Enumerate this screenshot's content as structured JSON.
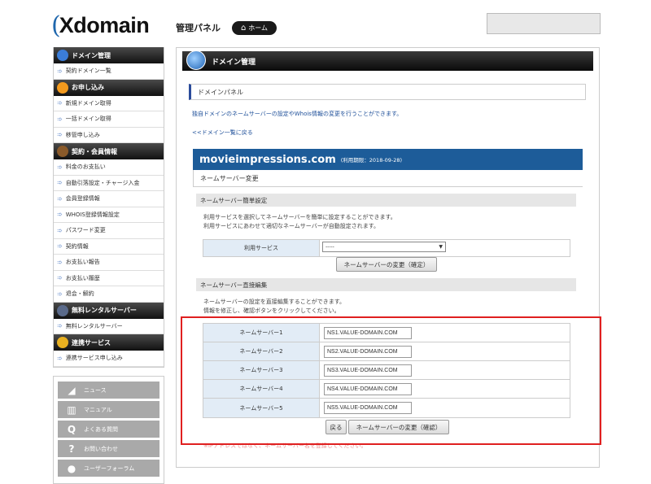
{
  "header": {
    "logo_text": "Xdomain",
    "panel_title": "管理パネル",
    "home_label": "ホーム"
  },
  "sidebar": {
    "sections": [
      {
        "title": "ドメイン管理",
        "icon": "globe-icon",
        "items": [
          "契約ドメイン一覧"
        ]
      },
      {
        "title": "お申し込み",
        "icon": "plus-icon",
        "items": [
          "新規ドメイン取得",
          "一括ドメイン取得",
          "移管申し込み"
        ]
      },
      {
        "title": "契約・会員情報",
        "icon": "user-icon",
        "items": [
          "料金のお支払い",
          "自動引落設定・チャージ入金",
          "会員登録情報",
          "WHOIS登録情報設定",
          "パスワード変更",
          "契約情報",
          "お支払い報告",
          "お支払い履歴",
          "退会・解約"
        ]
      },
      {
        "title": "無料レンタルサーバー",
        "icon": "server-icon",
        "items": [
          "無料レンタルサーバー"
        ]
      },
      {
        "title": "連携サービス",
        "icon": "link-icon",
        "items": [
          "連携サービス申し込み"
        ]
      }
    ],
    "support": [
      {
        "label": "ニュース",
        "icon": "megaphone-icon",
        "glyph": "◢"
      },
      {
        "label": "マニュアル",
        "icon": "book-icon",
        "glyph": "▥"
      },
      {
        "label": "よくある質問",
        "icon": "q-icon",
        "glyph": "Q"
      },
      {
        "label": "お問い合わせ",
        "icon": "question-icon",
        "glyph": "?"
      },
      {
        "label": "ユーザーフォーラム",
        "icon": "chat-icon",
        "glyph": "●"
      }
    ]
  },
  "main": {
    "title": "ドメイン管理",
    "panel_label": "ドメインパネル",
    "description": "独自ドメインのネームサーバーの設定やWhois情報の変更を行うことができます。",
    "back_link": "<<ドメイン一覧に戻る",
    "domain": "movieimpressions.com",
    "expiry": "(利用期限：2018-09-28)",
    "ns_change_title": "ネームサーバー変更",
    "simple": {
      "heading": "ネームサーバー簡単設定",
      "note1": "利用サービスを選択してネームサーバーを簡単に設定することができます。",
      "note2": "利用サービスにあわせて適切なネームサーバーが自動設定されます。",
      "service_label": "利用サービス",
      "select_value": "-----",
      "confirm_button": "ネームサーバーの変更（確定）"
    },
    "direct": {
      "heading": "ネームサーバー直接編集",
      "note1": "ネームサーバーの設定を直接編集することができます。",
      "note2": "情報を修正し、確認ボタンをクリックしてください。",
      "rows": [
        {
          "label": "ネームサーバー1",
          "value": "NS1.VALUE-DOMAIN.COM"
        },
        {
          "label": "ネームサーバー2",
          "value": "NS2.VALUE-DOMAIN.COM"
        },
        {
          "label": "ネームサーバー3",
          "value": "NS3.VALUE-DOMAIN.COM"
        },
        {
          "label": "ネームサーバー4",
          "value": "NS4.VALUE-DOMAIN.COM"
        },
        {
          "label": "ネームサーバー5",
          "value": "NS5.VALUE-DOMAIN.COM"
        }
      ],
      "back_button": "戻る",
      "confirm_button": "ネームサーバーの変更（確認）",
      "red_note": "※IPアドレスではなく、ネームサーバー名を登録してください。"
    }
  },
  "colors": {
    "highlight": "#e02020",
    "domain_bar": "#1d5c99"
  }
}
